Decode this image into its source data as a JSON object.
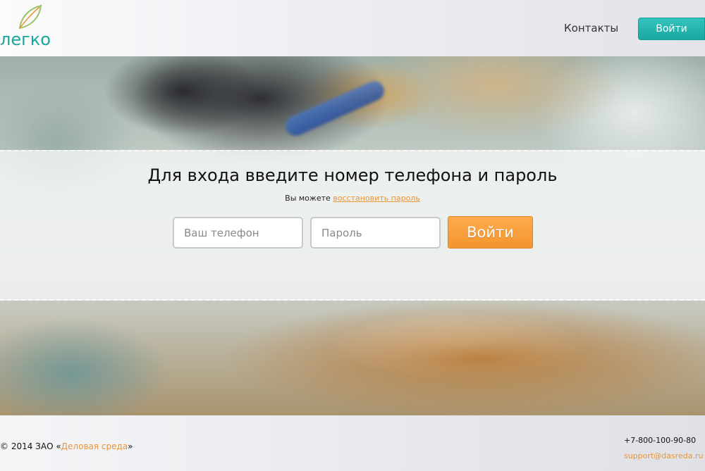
{
  "header": {
    "logo_text": "легко",
    "nav_contacts": "Контакты",
    "login_button": "Войти"
  },
  "hero": {
    "title": "Для входа введите номер телефона и пароль",
    "sub_prefix": "Вы можете ",
    "restore_link": "восстановить пароль",
    "phone_placeholder": "Ваш телефон",
    "password_placeholder": "Пароль",
    "submit_label": "Войти"
  },
  "footer": {
    "copyright_prefix": "© 2014 ЗАО «",
    "company_link": "Деловая среда",
    "copyright_suffix": "»",
    "phone": "+7-800-100-90-80",
    "email": "support@dasreda.ru"
  },
  "icons": {
    "logo_leaf": "leaf-icon"
  },
  "colors": {
    "brand_teal": "#1aa69c",
    "accent_orange": "#f39530",
    "link_orange": "#e8963a"
  }
}
